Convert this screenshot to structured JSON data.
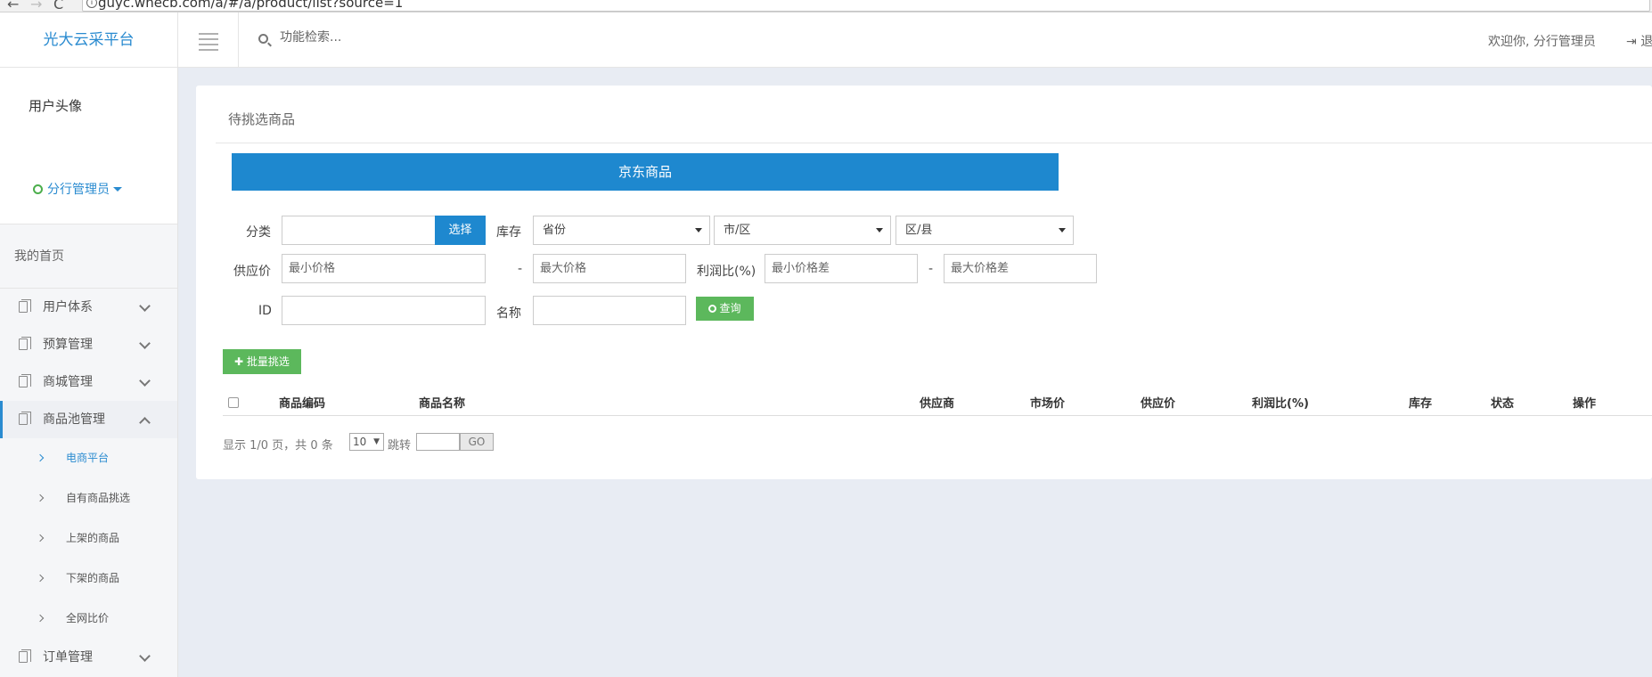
{
  "browser": {
    "url": "guyc.whecb.com/a/#/a/product/list?source=1"
  },
  "sidebar": {
    "brand": "光大云采平台",
    "avatar_alt": "用户头像",
    "role": "分行管理员",
    "home": "我的首页",
    "menu": [
      {
        "label": "用户体系"
      },
      {
        "label": "预算管理"
      },
      {
        "label": "商城管理"
      },
      {
        "label": "商品池管理"
      }
    ],
    "submenu": [
      {
        "label": "电商平台"
      },
      {
        "label": "自有商品挑选"
      },
      {
        "label": "上架的商品"
      },
      {
        "label": "下架的商品"
      },
      {
        "label": "全网比价"
      }
    ],
    "order_menu": "订单管理"
  },
  "header": {
    "search_placeholder": "功能检索...",
    "welcome": "欢迎你, 分行管理员",
    "logout": "退"
  },
  "panel": {
    "title": "待挑选商品",
    "tab": "京东商品",
    "filters": {
      "category_label": "分类",
      "choose_button": "选择",
      "stock_label": "库存",
      "province": "省份",
      "city": "市/区",
      "district": "区/县",
      "supply_price_label": "供应价",
      "min_price_placeholder": "最小价格",
      "dash": "-",
      "max_price_placeholder": "最大价格",
      "profit_label": "利润比(%)",
      "min_diff_placeholder": "最小价格差",
      "max_diff_placeholder": "最大价格差",
      "id_label": "ID",
      "name_label": "名称",
      "query_button": "查询"
    },
    "batch_button": "批量挑选",
    "table": {
      "columns": [
        "商品编码",
        "商品名称",
        "供应商",
        "市场价",
        "供应价",
        "利润比(%)",
        "库存",
        "状态",
        "操作"
      ]
    },
    "pager": {
      "summary": "显示 1/0 页，共 0 条",
      "page_size": "10",
      "jump_label": "跳转",
      "go": "GO"
    }
  }
}
